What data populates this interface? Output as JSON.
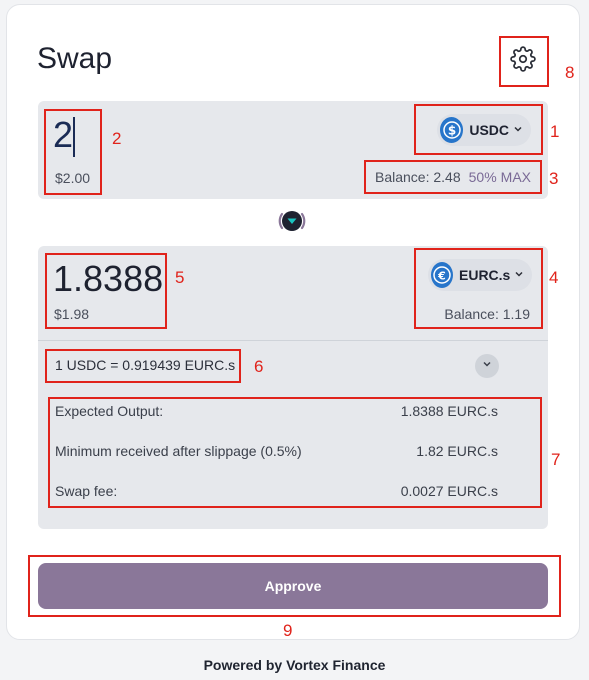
{
  "header": {
    "title": "Swap"
  },
  "from": {
    "amount": "2",
    "usd_value": "$2.00",
    "token": "USDC",
    "balance_label": "Balance: 2.48",
    "pct_label": "50%",
    "max_label": "MAX"
  },
  "to": {
    "amount": "1.8388",
    "usd_value": "$1.98",
    "token": "EURC.s",
    "balance_label": "Balance: 1.19"
  },
  "rate": {
    "text": "1 USDC = 0.919439 EURC.s"
  },
  "details": [
    {
      "label": "Expected Output:",
      "value": "1.8388 EURC.s"
    },
    {
      "label": "Minimum received after slippage (0.5%)",
      "value": "1.82 EURC.s"
    },
    {
      "label": "Swap fee:",
      "value": "0.0027 EURC.s"
    }
  ],
  "actions": {
    "approve_label": "Approve"
  },
  "footer": {
    "powered_by": "Powered by Vortex Finance"
  },
  "annotations": [
    "1",
    "2",
    "3",
    "4",
    "5",
    "6",
    "7",
    "8",
    "9"
  ],
  "colors": {
    "usdc": "#2775ca",
    "eurc": "#2775ca",
    "approve": "#8a7799",
    "annotation": "#e0231b",
    "flip_accent": "#19c4c0"
  },
  "icons": {
    "settings": "gear-icon",
    "usdc": "usdc-icon",
    "eurc": "eurc-icon",
    "flip": "swap-direction-icon",
    "expand": "chevron-down-icon"
  }
}
